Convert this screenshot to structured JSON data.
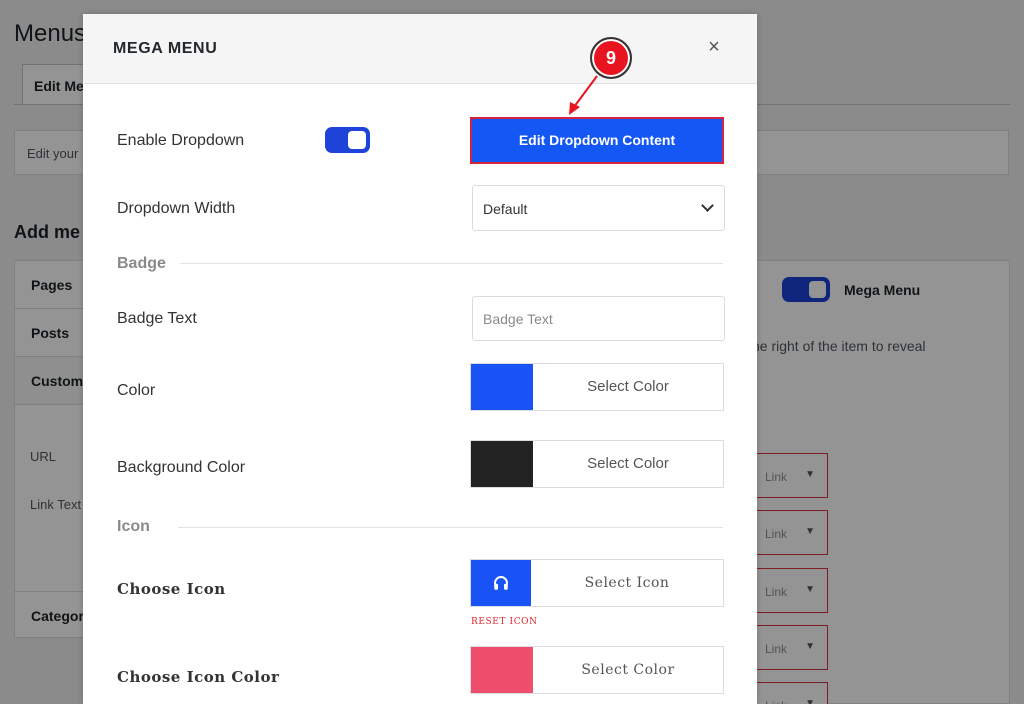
{
  "background": {
    "page_title": "Menus",
    "tab_label": "Edit Me",
    "edit_bar_text": "Edit your",
    "add_heading": "Add me",
    "accordion": [
      "Pages",
      "Posts",
      "Custom"
    ],
    "url_label": "URL",
    "link_text_label": "Link Text",
    "categories_label": "Categor",
    "mega_menu_label": "Mega Menu",
    "reveal_text": "he right of the item to reveal",
    "link_select_label": "Link"
  },
  "modal": {
    "title": "MEGA MENU",
    "close_icon": "×",
    "enable_dropdown": {
      "label": "Enable Dropdown",
      "enabled": true
    },
    "edit_button": {
      "label": "Edit Dropdown Content"
    },
    "dropdown_width": {
      "label": "Dropdown Width",
      "value": "Default"
    },
    "badge_section": "Badge",
    "badge_text": {
      "label": "Badge Text",
      "placeholder": "Badge Text"
    },
    "color": {
      "label": "Color",
      "swatch": "#1a53f5",
      "button": "Select Color"
    },
    "background_color": {
      "label": "Background Color",
      "swatch": "#222222",
      "button": "Select Color"
    },
    "icon_section": "Icon",
    "choose_icon": {
      "label": "Choose Icon",
      "swatch": "#1a53f5",
      "icon": "headphones-icon",
      "button": "Select Icon",
      "reset": "RESET ICON"
    },
    "choose_icon_color": {
      "label": "Choose Icon Color",
      "swatch": "#ef4f6d",
      "button": "Select Color"
    }
  },
  "annotation": {
    "step": "9",
    "color": "#e8141f"
  }
}
